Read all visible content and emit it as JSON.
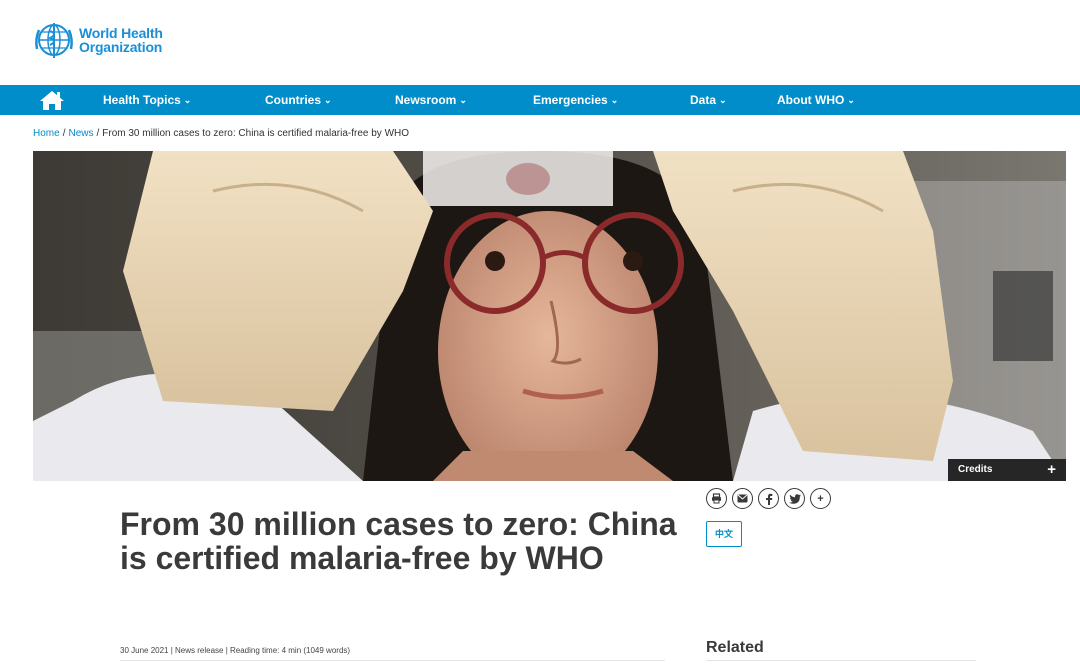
{
  "logo": {
    "line1": "World Health",
    "line2": "Organization"
  },
  "nav": {
    "items": [
      {
        "label": "Health Topics"
      },
      {
        "label": "Countries"
      },
      {
        "label": "Newsroom"
      },
      {
        "label": "Emergencies"
      },
      {
        "label": "Data"
      },
      {
        "label": "About WHO"
      }
    ]
  },
  "breadcrumb": {
    "home": "Home",
    "news": "News",
    "current": "From 30 million cases to zero: China is certified malaria-free by WHO"
  },
  "hero": {
    "credits_label": "Credits",
    "credits_toggle": "+"
  },
  "article": {
    "title": "From 30 million cases to zero: China is certified malaria-free by WHO",
    "meta": "30 June 2021 | News release | Reading time: 4 min (1049 words)"
  },
  "share": {
    "more": "+"
  },
  "language": {
    "label": "中文"
  },
  "sidebar": {
    "related_heading": "Related"
  },
  "colors": {
    "brand_blue": "#008dc9",
    "logo_blue": "#1a8fd6"
  }
}
